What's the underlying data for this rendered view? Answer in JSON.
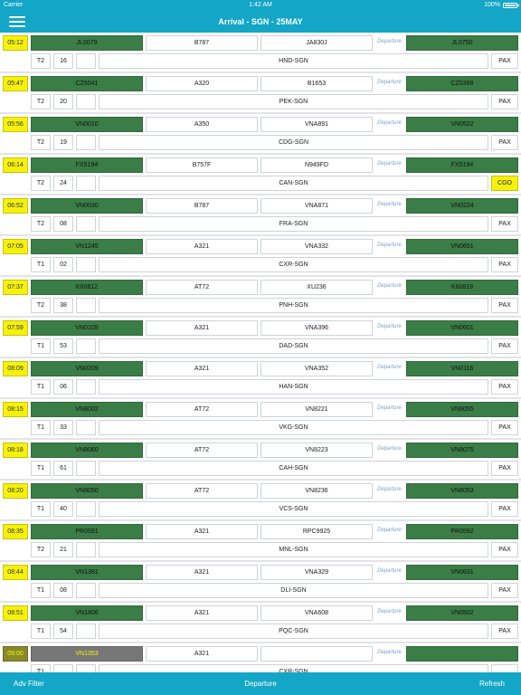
{
  "status_bar": {
    "carrier": "Carrier",
    "time": "1:42 AM",
    "battery": "100%"
  },
  "header": {
    "title": "Arrival - SGN - 25MAY"
  },
  "dep_label": "Departure",
  "flights": [
    {
      "time": "05:12",
      "arr_flight": "JL0079",
      "ac_type": "B787",
      "registration": "JA830J",
      "dep_flight": "JL0750",
      "terminal": "T2",
      "gate": "16",
      "belt": "",
      "route": "HND-SGN",
      "load": "PAX"
    },
    {
      "time": "05:47",
      "arr_flight": "CZ6041",
      "ac_type": "A320",
      "registration": "B1653",
      "dep_flight": "CZ0368",
      "terminal": "T2",
      "gate": "20",
      "belt": "",
      "route": "PEK-SGN",
      "load": "PAX"
    },
    {
      "time": "05:56",
      "arr_flight": "VN0010",
      "ac_type": "A350",
      "registration": "VNA891",
      "dep_flight": "VN0522",
      "terminal": "T2",
      "gate": "19",
      "belt": "",
      "route": "CDG-SGN",
      "load": "PAX"
    },
    {
      "time": "06:14",
      "arr_flight": "FX5194",
      "ac_type": "B757F",
      "registration": "N949FD",
      "dep_flight": "FX5194",
      "terminal": "T2",
      "gate": "24",
      "belt": "",
      "route": "CAN-SGN",
      "load": "CGO"
    },
    {
      "time": "06:52",
      "arr_flight": "VN0030",
      "ac_type": "B787",
      "registration": "VNA871",
      "dep_flight": "VN0224",
      "terminal": "T2",
      "gate": "08",
      "belt": "",
      "route": "FRA-SGN",
      "load": "PAX"
    },
    {
      "time": "07:05",
      "arr_flight": "VN1245",
      "ac_type": "A321",
      "registration": "VNA332",
      "dep_flight": "VN0651",
      "terminal": "T1",
      "gate": "02",
      "belt": "",
      "route": "CXR-SGN",
      "load": "PAX"
    },
    {
      "time": "07:37",
      "arr_flight": "K60812",
      "ac_type": "AT72",
      "registration": "XU236",
      "dep_flight": "K60819",
      "terminal": "T2",
      "gate": "38",
      "belt": "",
      "route": "PNH-SGN",
      "load": "PAX"
    },
    {
      "time": "07:59",
      "arr_flight": "VN0105",
      "ac_type": "A321",
      "registration": "VNA396",
      "dep_flight": "VN0601",
      "terminal": "T1",
      "gate": "53",
      "belt": "",
      "route": "DAD-SGN",
      "load": "PAX"
    },
    {
      "time": "08:09",
      "arr_flight": "VN0209",
      "ac_type": "A321",
      "registration": "VNA352",
      "dep_flight": "VN0116",
      "terminal": "T1",
      "gate": "06",
      "belt": "",
      "route": "HAN-SGN",
      "load": "PAX"
    },
    {
      "time": "08:15",
      "arr_flight": "VN8002",
      "ac_type": "AT72",
      "registration": "VN8221",
      "dep_flight": "VN8055",
      "terminal": "T1",
      "gate": "33",
      "belt": "",
      "route": "VKG-SGN",
      "load": "PAX"
    },
    {
      "time": "08:18",
      "arr_flight": "VN8060",
      "ac_type": "AT72",
      "registration": "VN8223",
      "dep_flight": "VN8075",
      "terminal": "T1",
      "gate": "61",
      "belt": "",
      "route": "CAH-SGN",
      "load": "PAX"
    },
    {
      "time": "08:20",
      "arr_flight": "VN8050",
      "ac_type": "AT72",
      "registration": "VN8236",
      "dep_flight": "VN8053",
      "terminal": "T1",
      "gate": "40",
      "belt": "",
      "route": "VCS-SGN",
      "load": "PAX"
    },
    {
      "time": "08:35",
      "arr_flight": "PR0591",
      "ac_type": "A321",
      "registration": "RPC9925",
      "dep_flight": "PR0592",
      "terminal": "T2",
      "gate": "21",
      "belt": "",
      "route": "MNL-SGN",
      "load": "PAX"
    },
    {
      "time": "08:44",
      "arr_flight": "VN1381",
      "ac_type": "A321",
      "registration": "VNA329",
      "dep_flight": "VN0631",
      "terminal": "T1",
      "gate": "08",
      "belt": "",
      "route": "DLI-SGN",
      "load": "PAX"
    },
    {
      "time": "08:51",
      "arr_flight": "VN1806",
      "ac_type": "A321",
      "registration": "VNA608",
      "dep_flight": "VN0502",
      "terminal": "T1",
      "gate": "54",
      "belt": "",
      "route": "PQC-SGN",
      "load": "PAX"
    },
    {
      "time": "09:00",
      "arr_flight": "VN1353",
      "ac_type": "A321",
      "registration": "",
      "dep_flight": "",
      "terminal": "T1",
      "gate": "",
      "belt": "",
      "route": "CXR-SGN",
      "load": "",
      "delayed": true
    }
  ],
  "bottom_bar": {
    "left": "Adv Filter",
    "center": "Departure",
    "right": "Refresh"
  },
  "colors": {
    "bar": "#13a6c6",
    "arrival_cell": "#3a7d46",
    "time_cell": "#f5f10b",
    "delayed_cell": "#777777",
    "background": "#efeff4"
  }
}
